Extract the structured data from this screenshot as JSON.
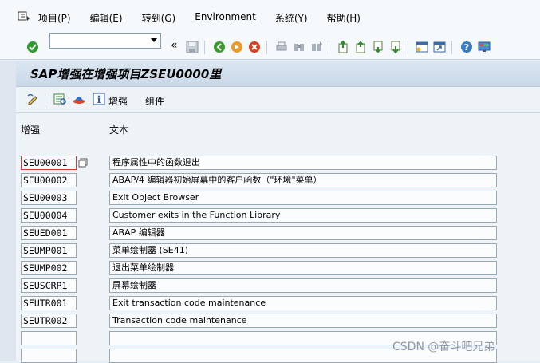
{
  "menubar": {
    "items": [
      "项目(P)",
      "编辑(E)",
      "转到(G)",
      "Environment",
      "系统(Y)",
      "帮助(H)"
    ]
  },
  "toolbar": {
    "command_value": "",
    "collapse_glyph": "«"
  },
  "screen": {
    "title": "SAP增强在增强项目ZSEU0000里"
  },
  "app_toolbar": {
    "enhancement_label": "增强",
    "components_label": "组件"
  },
  "table": {
    "col_key": "增强",
    "col_text": "文本",
    "rows": [
      {
        "key": "SEU00001",
        "text": "程序属性中的函数退出"
      },
      {
        "key": "SEU00002",
        "text": "ABAP/4 编辑器初始屏幕中的客户函数（\"环境\"菜单）"
      },
      {
        "key": "SEU00003",
        "text": "Exit Object Browser"
      },
      {
        "key": "SEU00004",
        "text": "Customer exits in the Function Library"
      },
      {
        "key": "SEUED001",
        "text": "ABAP 编辑器"
      },
      {
        "key": "SEUMP001",
        "text": "菜单绘制器 (SE41)"
      },
      {
        "key": "SEUMP002",
        "text": "退出菜单绘制器"
      },
      {
        "key": "SEUSCRP1",
        "text": "屏幕绘制器"
      },
      {
        "key": "SEUTR001",
        "text": "Exit transaction code maintenance"
      },
      {
        "key": "SEUTR002",
        "text": "Transaction code maintenance"
      },
      {
        "key": "",
        "text": ""
      },
      {
        "key": "",
        "text": ""
      }
    ]
  },
  "watermark": "CSDN @奋斗吧兄弟",
  "colors": {
    "background": "#e6eef6",
    "selected_border": "#d23b3b"
  }
}
